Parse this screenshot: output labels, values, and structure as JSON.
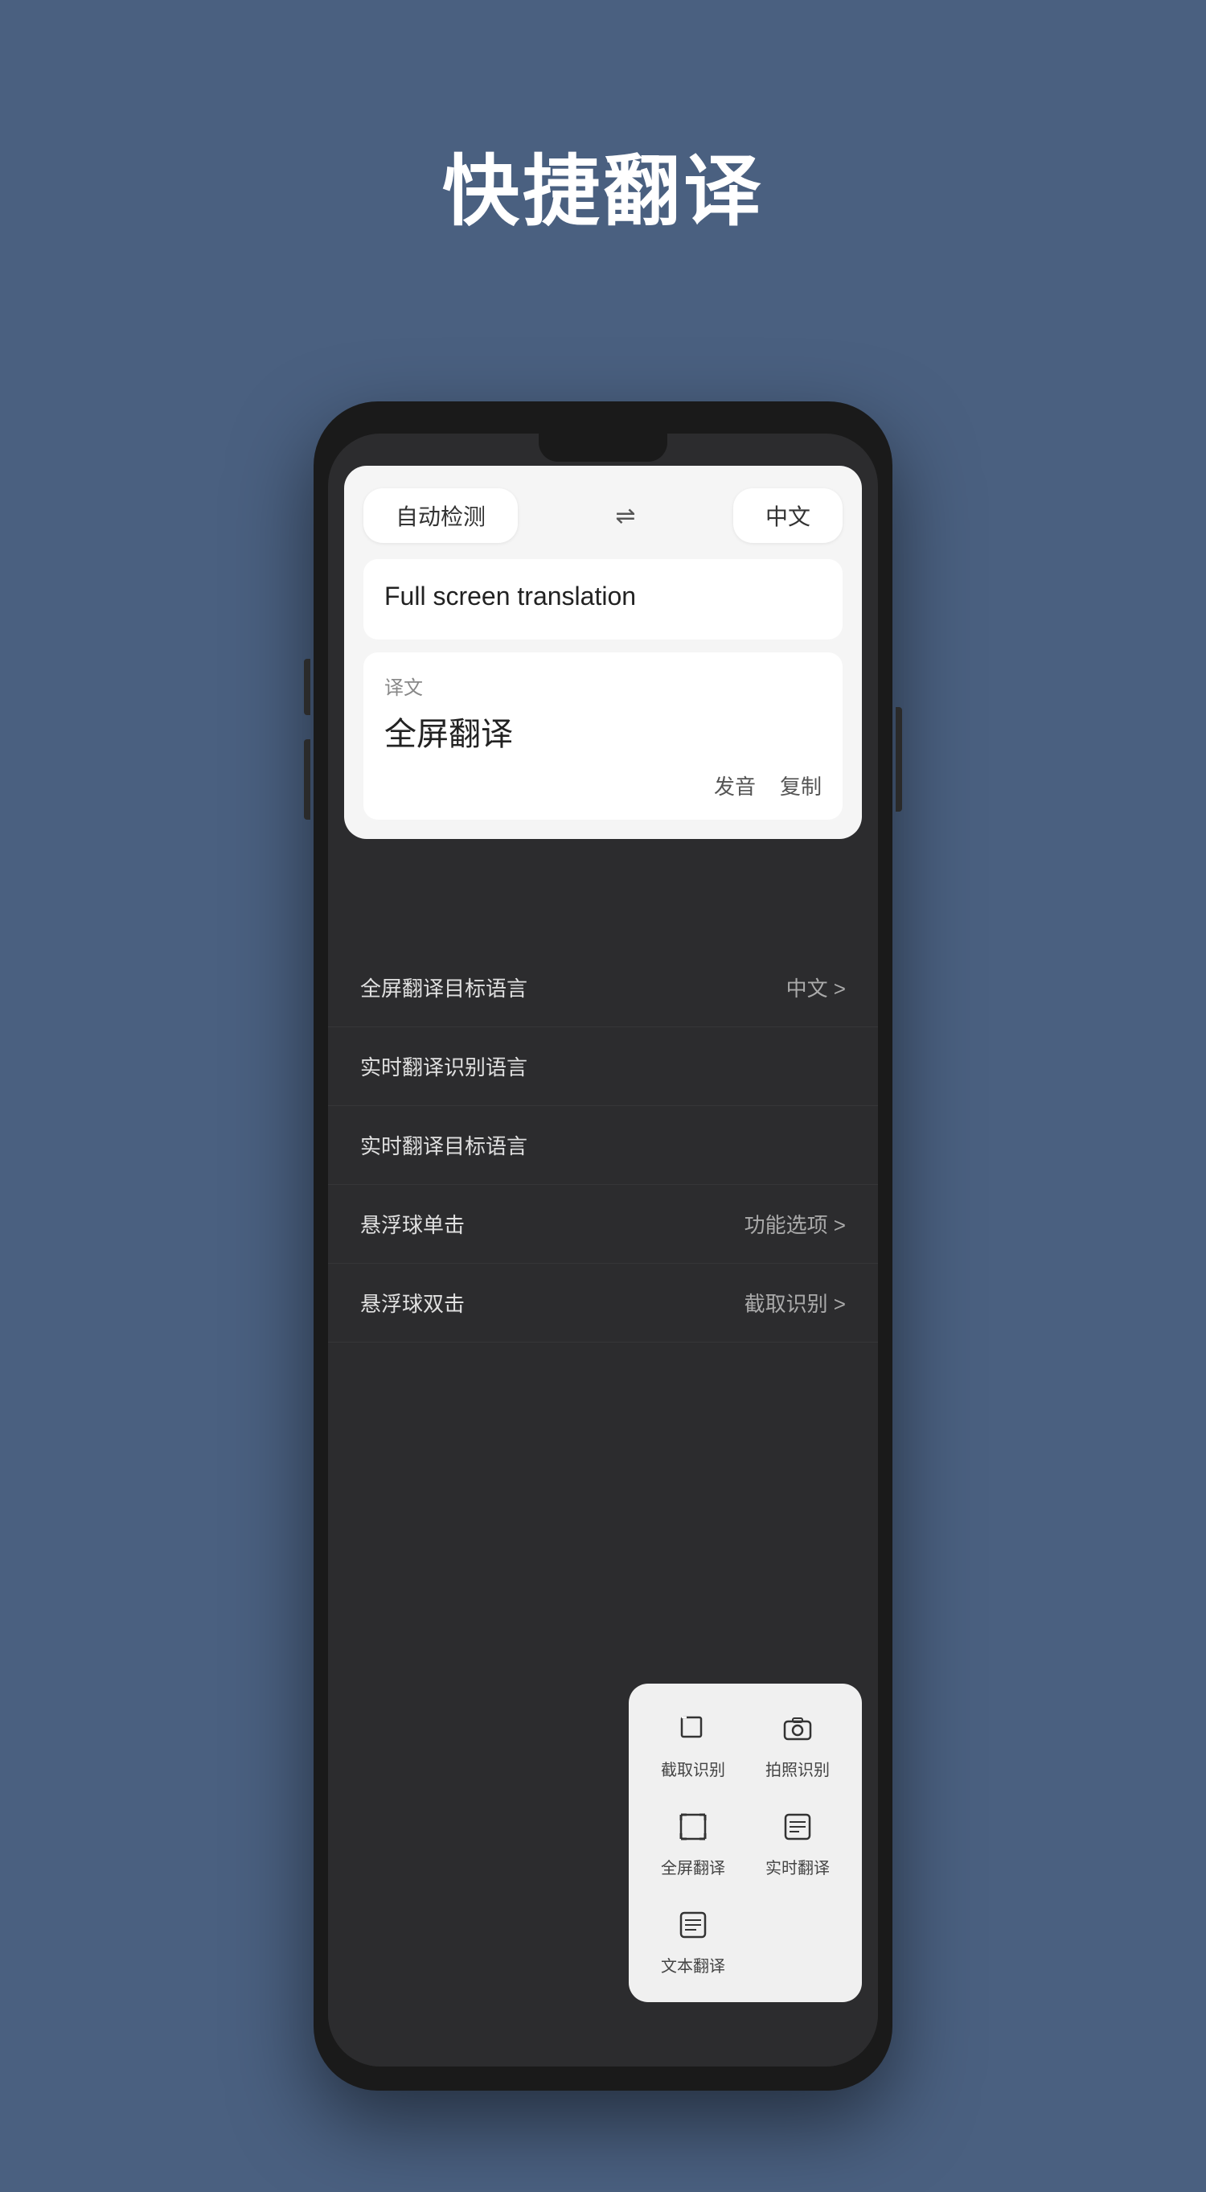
{
  "page": {
    "title": "快捷翻译",
    "background_color": "#4a6080"
  },
  "translator": {
    "source_lang": "自动检测",
    "target_lang": "中文",
    "swap_icon": "⇌",
    "input_text": "Full screen translation",
    "translation_label": "译文",
    "translation_text": "全屏翻译",
    "pronounce_btn": "发音",
    "copy_btn": "复制"
  },
  "settings": {
    "items": [
      {
        "label": "全屏翻译目标语言",
        "value": "中文 >"
      },
      {
        "label": "实时翻译识别语言",
        "value": ""
      },
      {
        "label": "实时翻译目标语言",
        "value": ""
      },
      {
        "label": "悬浮球单击",
        "value": "功能选项 >"
      },
      {
        "label": "悬浮球双击",
        "value": "截取识别 >"
      }
    ]
  },
  "quick_actions": {
    "items": [
      {
        "label": "截取识别",
        "icon": "✂"
      },
      {
        "label": "拍照识别",
        "icon": "📷"
      },
      {
        "label": "全屏翻译",
        "icon": "⬜"
      },
      {
        "label": "实时翻译",
        "icon": "📋"
      },
      {
        "label": "文本翻译",
        "icon": "📄"
      }
    ]
  }
}
